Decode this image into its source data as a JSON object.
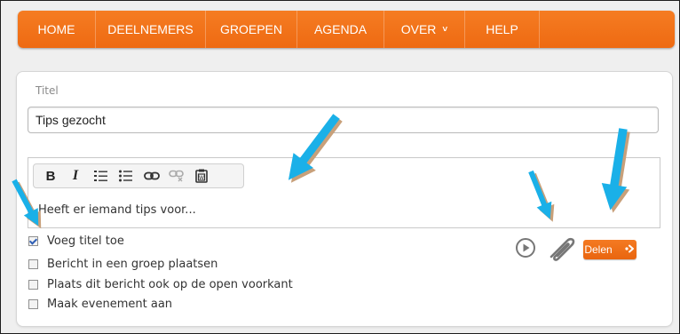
{
  "nav": {
    "items": [
      {
        "label": "HOME"
      },
      {
        "label": "DEELNEMERS"
      },
      {
        "label": "GROEPEN"
      },
      {
        "label": "AGENDA"
      },
      {
        "label": "OVER"
      },
      {
        "label": "HELP"
      }
    ],
    "dropdown_icon": "chevron-down-icon"
  },
  "post": {
    "title_label": "Titel",
    "title_value": "Tips gezocht",
    "editor_text": "Heeft er iemand tips voor...",
    "toolbar": [
      "bold-icon",
      "italic-icon",
      "numbered-list-icon",
      "bullet-list-icon",
      "link-icon",
      "unlink-icon",
      "paste-word-icon"
    ],
    "toolbar_glyphs": {
      "bold": "B",
      "italic": "I"
    }
  },
  "options": [
    {
      "label": "Voeg titel toe",
      "checked": true
    },
    {
      "label": "Bericht in een groep plaatsen",
      "checked": false
    },
    {
      "label": "Plaats dit bericht ook op de open voorkant",
      "checked": false
    },
    {
      "label": "Maak evenement aan",
      "checked": false
    }
  ],
  "actions": {
    "video_icon": "play-circle-icon",
    "attach_icon": "paperclip-icon",
    "share_label": "Delen"
  },
  "colors": {
    "accent": "#f07020",
    "arrow": "#1ab0e8",
    "arrow_shadow": "#c8a07a"
  }
}
